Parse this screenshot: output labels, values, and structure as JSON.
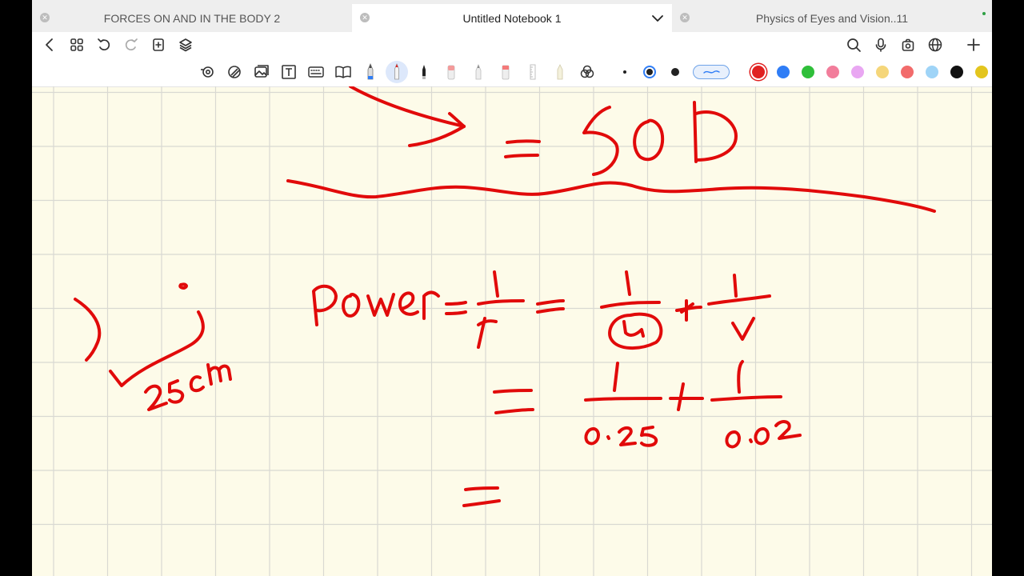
{
  "tabs": [
    {
      "title": "FORCES ON AND IN THE BODY 2",
      "active": false
    },
    {
      "title": "Untitled Notebook 1",
      "active": true
    },
    {
      "title": "Physics of Eyes and Vision..11",
      "active": false
    }
  ],
  "nav": {
    "left_icons": [
      "back-icon",
      "grid-icon",
      "undo-icon",
      "redo-icon",
      "add-page-icon",
      "layers-icon"
    ],
    "right_icons": [
      "search-icon",
      "microphone-icon",
      "share-icon",
      "globe-icon",
      "plus-icon"
    ]
  },
  "toolbar": {
    "tools": [
      "lasso-icon",
      "shape-icon",
      "image-icon",
      "text-icon",
      "keyboard-icon",
      "book-icon",
      "fountain-pen-icon",
      "ballpoint-pen-icon",
      "brush-pen-icon",
      "eraser-icon",
      "pencil-icon",
      "highlighter-icon",
      "ruler-icon",
      "marker-icon",
      "shapes-icon"
    ],
    "active_tool": "ballpoint-pen-icon",
    "stroke_sizes": [
      "fine",
      "medium",
      "bold"
    ],
    "selected_stroke_size": "medium",
    "stroke_style": "smooth",
    "colors": [
      "#e02020",
      "#2f7df6",
      "#2fbf3a",
      "#f27d9b",
      "#e9a7f2",
      "#f5d67a",
      "#f26b6b",
      "#9fd4f7",
      "#111111",
      "#e3c51e"
    ],
    "selected_color": "#e02020"
  },
  "canvas": {
    "paper_color": "#fdfbe9",
    "grid_color": "#d9d9d2",
    "ink_color": "#e10a0a",
    "handwriting": {
      "result": "= 50D",
      "formula": "Power = 1/f = 1/u + 1/v",
      "substitution": "= 1/0.25 + 1/0.02",
      "next_step": "=",
      "distance_note": "25cm"
    }
  }
}
